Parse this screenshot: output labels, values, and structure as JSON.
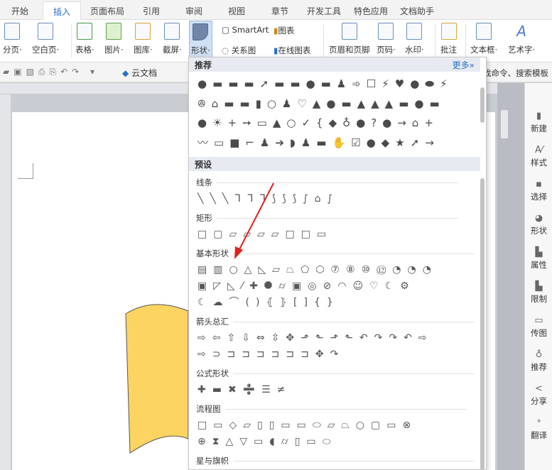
{
  "tabs": [
    "开始",
    "插入",
    "页面布局",
    "引用",
    "审阅",
    "视图",
    "章节",
    "开发工具",
    "特色应用",
    "文档助手"
  ],
  "ribbon": {
    "page_break": "分页·",
    "blank_page": "空白页·",
    "table": "表格·",
    "picture": "图片·",
    "gallery": "图库·",
    "screenshot": "截屏·",
    "shape": "形状·",
    "smartart": "SmartArt",
    "chart": "图表",
    "relation": "关系图",
    "online_chart": "在线图表",
    "header_footer": "页眉和页脚",
    "page_num": "页码·",
    "watermark": "水印·",
    "comment": "批注",
    "textbox": "文本框·",
    "wordart": "艺术字·"
  },
  "quickbar": {
    "cloud": "云文档",
    "search": "找命令、搜索模板"
  },
  "sidebar": [
    "新建",
    "样式",
    "选择",
    "形状",
    "属性",
    "限制",
    "传图",
    "推荐",
    "分享",
    "翻译"
  ],
  "dropdown": {
    "recommend": "推荐",
    "more": "更多»",
    "preset": "预设",
    "rec_rows": [
      "●▬▬▬➚▬▬●▬♟➾☐⚡♥●⬬⚡",
      "ꔮ⌂▬▬▮○♟♡▲●▬▲▲▲▬●▬",
      "●☀+➙▭▲○✓{◆♁●?●→⌂+",
      "〰▭■⌐♟➔◗♟▬✋☑●◆★➚→"
    ],
    "categories": [
      {
        "name": "线条",
        "rows": [
          "╲╲╲ᒣᒣᒣ⟆⟆⟆∫⌂∫"
        ]
      },
      {
        "name": "矩形",
        "rows": [
          "□▢▱▱▱▱□□▭"
        ]
      },
      {
        "name": "基本形状",
        "rows": [
          "▤▥○△◺▱⏢⬠⬡⑦⑧⑩⑫◔◔◔",
          "▣◸◺⁄✚⯃⌭▣◎⊘◠☺♡☾⚙",
          "☾☁⌒()⦃⦄[]{}"
        ]
      },
      {
        "name": "箭头总汇",
        "rows": [
          "⇨⇦⇧⇩⇔⇳✥⬏⬑⬏⬑↶↷↷↶⇨",
          "⇨⊃⊐⊐⊐⊐⊐⊐✥↷"
        ]
      },
      {
        "name": "公式形状",
        "rows": [
          "✚▬✖➗☰≠"
        ]
      },
      {
        "name": "流程图",
        "rows": [
          "□▭◇▱▯▯▭▭⬭▱⏢○▢▭⊗",
          "⊕⧗△▽▭◖⌭▯▭⬭"
        ]
      },
      {
        "name": "星与旗帜",
        "rows": []
      }
    ]
  },
  "colors": {
    "accent": "#2a6fc9",
    "shape_fill": "#fcd462"
  }
}
